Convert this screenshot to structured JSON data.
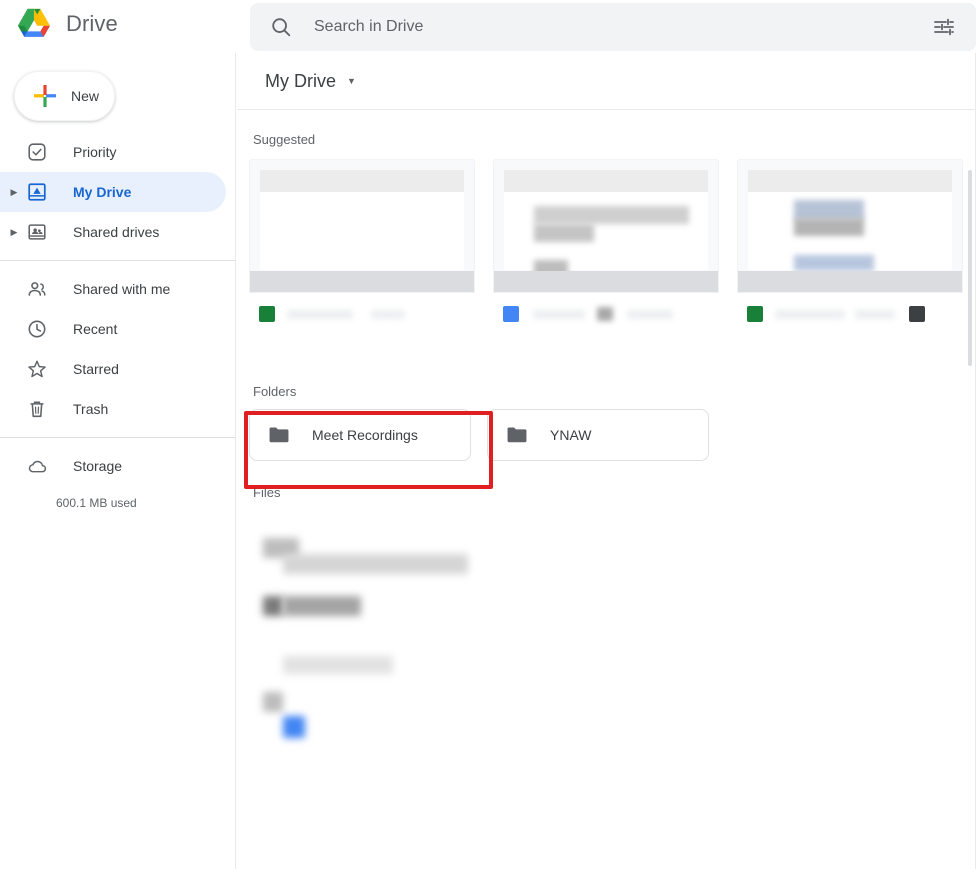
{
  "app": {
    "title": "Drive",
    "logo_icon": "google-drive-logo"
  },
  "search": {
    "placeholder": "Search in Drive",
    "value": "",
    "search_icon": "search-icon",
    "filter_icon": "tune-filter-icon"
  },
  "sidebar": {
    "new_button": {
      "label": "New",
      "icon": "plus-icon"
    },
    "items": [
      {
        "label": "Priority",
        "icon": "check-circle-icon",
        "expandable": false,
        "active": false
      },
      {
        "label": "My Drive",
        "icon": "my-drive-icon",
        "expandable": true,
        "active": true
      },
      {
        "label": "Shared drives",
        "icon": "shared-drives-icon",
        "expandable": true,
        "active": false
      },
      {
        "label": "Shared with me",
        "icon": "people-icon",
        "expandable": false,
        "active": false
      },
      {
        "label": "Recent",
        "icon": "clock-icon",
        "expandable": false,
        "active": false
      },
      {
        "label": "Starred",
        "icon": "star-icon",
        "expandable": false,
        "active": false
      },
      {
        "label": "Trash",
        "icon": "trash-icon",
        "expandable": false,
        "active": false
      },
      {
        "label": "Storage",
        "icon": "cloud-icon",
        "expandable": false,
        "active": false
      }
    ],
    "storage_used": "600.1 MB used"
  },
  "main": {
    "breadcrumb": "My Drive",
    "breadcrumb_caret_icon": "chevron-down-icon",
    "suggested_label": "Suggested",
    "folders_label": "Folders",
    "files_label": "Files",
    "suggested_cards": [
      {
        "name": "suggested-card-1",
        "filetype_color": "#188038",
        "redacted": true
      },
      {
        "name": "suggested-card-2",
        "filetype_color": "#4285f4",
        "redacted": true
      },
      {
        "name": "suggested-card-3",
        "filetype_color": "#188038",
        "redacted": true
      }
    ],
    "folders": [
      {
        "label": "Meet Recordings",
        "icon": "folder-icon",
        "highlighted": true
      },
      {
        "label": "YNAW",
        "icon": "folder-icon",
        "highlighted": false
      }
    ],
    "files_redacted": true
  },
  "colors": {
    "accent_blue": "#1967d2",
    "active_pill": "#e8f0fe",
    "highlight_red": "#e02020",
    "text_primary": "#3c4043",
    "text_secondary": "#5f6368",
    "search_bg": "#f1f3f4"
  }
}
